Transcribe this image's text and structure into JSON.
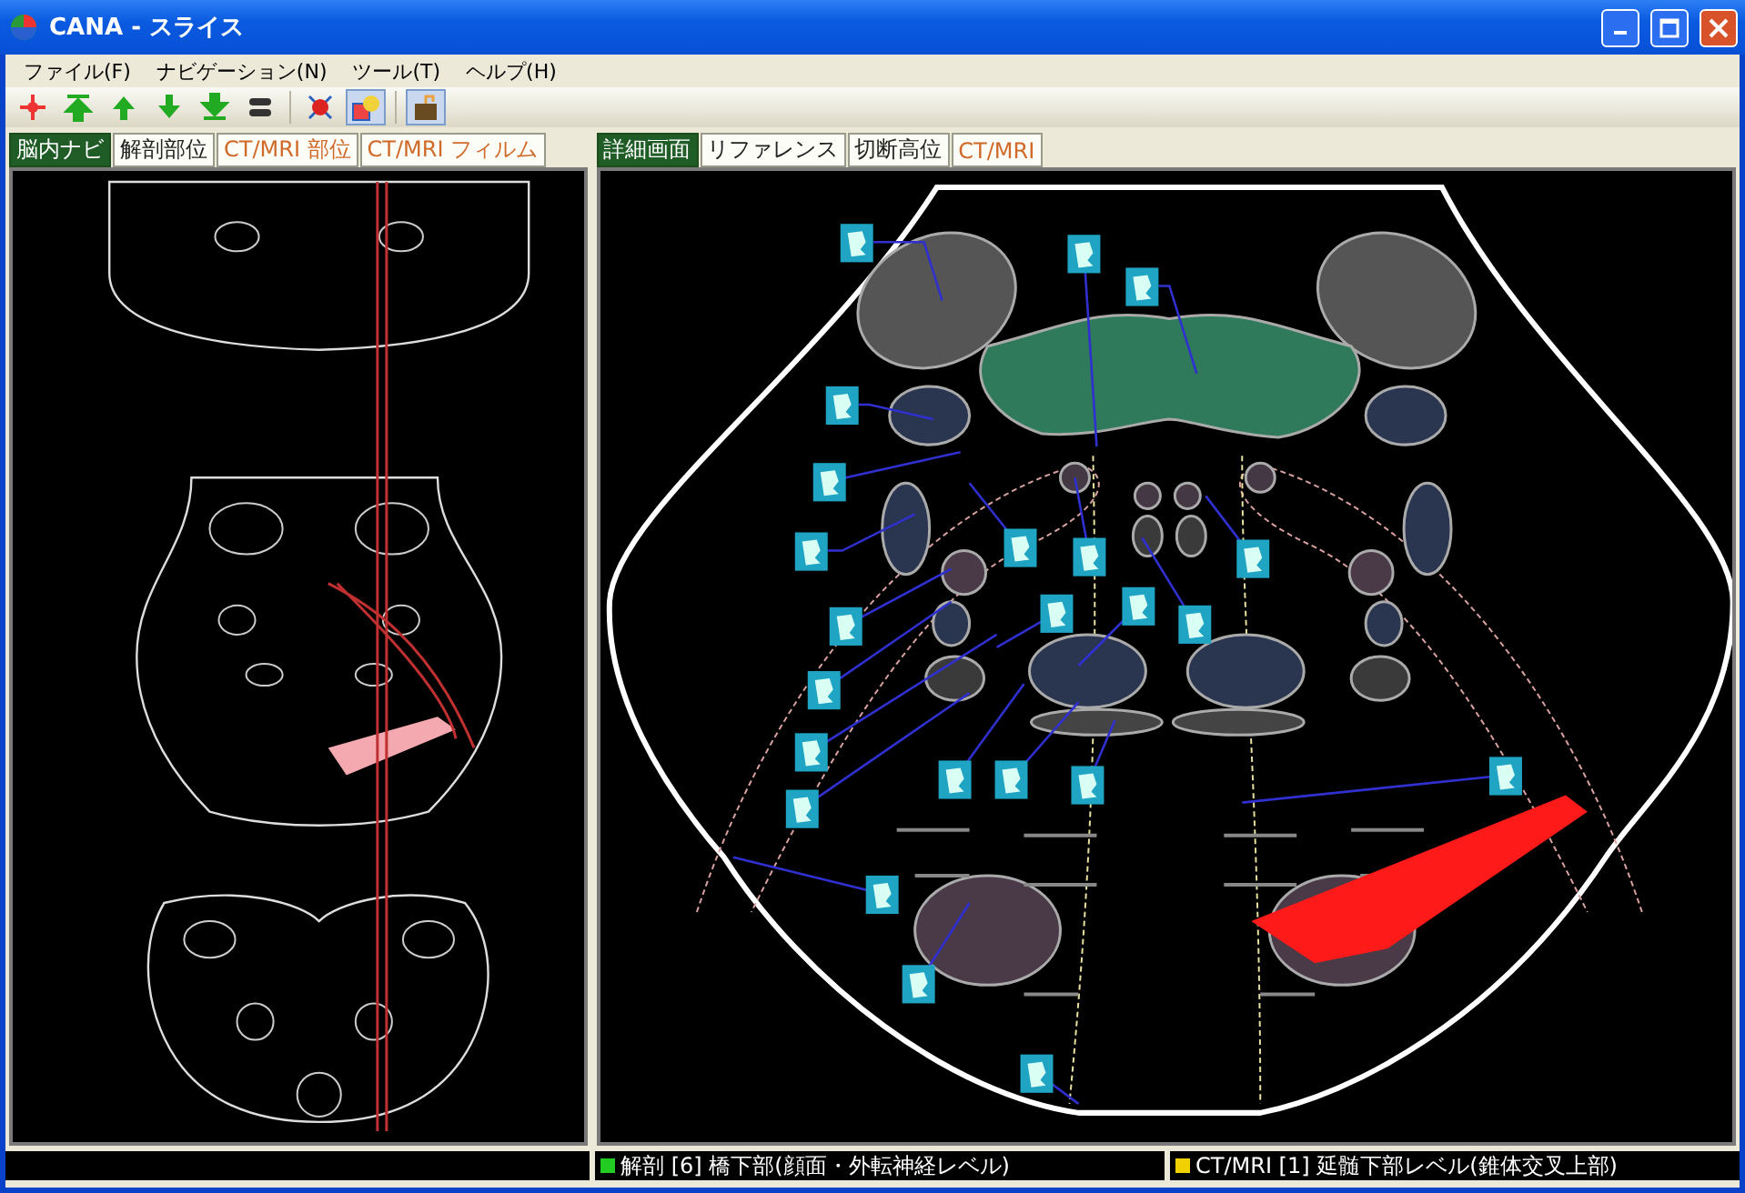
{
  "window": {
    "title": "CANA - スライス"
  },
  "menu": [
    {
      "label": "ファイル(F)"
    },
    {
      "label": "ナビゲーション(N)"
    },
    {
      "label": "ツール(T)"
    },
    {
      "label": "ヘルプ(H)"
    }
  ],
  "toolbar": [
    {
      "kind": "center",
      "selected": false
    },
    {
      "kind": "top",
      "selected": false
    },
    {
      "kind": "up",
      "selected": false
    },
    {
      "kind": "down",
      "selected": false
    },
    {
      "kind": "bottom",
      "selected": false
    },
    {
      "kind": "equal",
      "selected": false
    },
    {
      "kind": "target",
      "selected": false
    },
    {
      "kind": "overlay",
      "selected": true
    },
    {
      "kind": "film",
      "selected": true
    }
  ],
  "left_tabs": [
    {
      "label": "脳内ナビ",
      "selected": true,
      "kind": "anatomy"
    },
    {
      "label": "解剖部位",
      "selected": false,
      "kind": "anatomy"
    },
    {
      "label": "CT/MRI 部位",
      "selected": false,
      "kind": "imaging"
    },
    {
      "label": "CT/MRI フィルム",
      "selected": false,
      "kind": "imaging"
    }
  ],
  "right_tabs": [
    {
      "label": "詳細画面",
      "selected": true,
      "kind": "anatomy"
    },
    {
      "label": "リファレンス",
      "selected": false,
      "kind": "anatomy"
    },
    {
      "label": "切断高位",
      "selected": false,
      "kind": "anatomy"
    },
    {
      "label": "CT/MRI",
      "selected": false,
      "kind": "imaging"
    }
  ],
  "status_bar": [
    {
      "text": "解剖 [6] 橋下部(顔面・外転神経レベル)",
      "color": "#22cc22"
    },
    {
      "text": "CT/MRI [1] 延髄下部レベル(錐体交叉上部)",
      "color": "#f0d000"
    }
  ]
}
